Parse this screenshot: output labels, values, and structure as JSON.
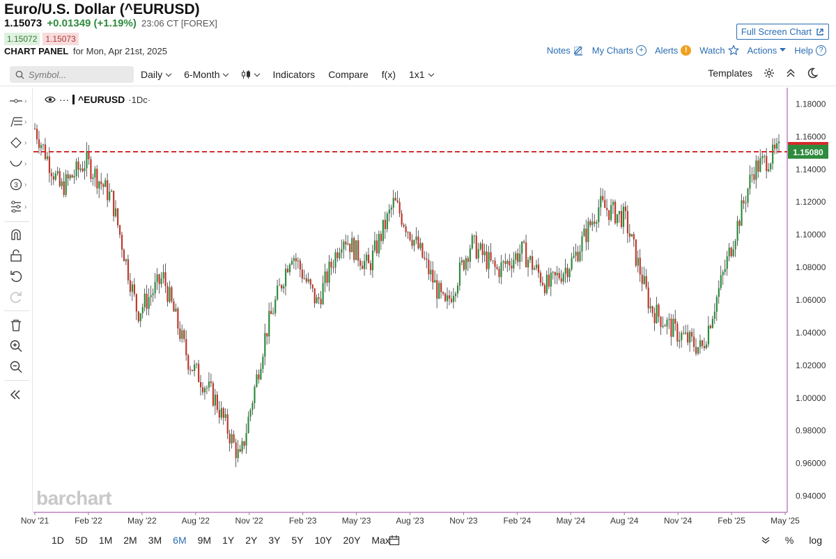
{
  "header": {
    "title": "Euro/U.S. Dollar (^EURUSD)",
    "last": "1.15073",
    "change": "+0.01349 (+1.19%)",
    "time": "23:06 CT [FOREX]",
    "bid": "1.15072",
    "ask": "1.15073",
    "panel_label": "CHART PANEL",
    "panel_date": "for Mon, Apr 21st, 2025",
    "fullscreen_label": "Full Screen Chart",
    "links": {
      "notes": "Notes",
      "mycharts": "My Charts",
      "alerts": "Alerts",
      "alerts_badge": "!",
      "watch": "Watch",
      "actions": "Actions",
      "help": "Help"
    }
  },
  "toolbar": {
    "symbol_placeholder": "Symbol...",
    "interval": "Daily",
    "period": "6-Month",
    "indicators": "Indicators",
    "compare": "Compare",
    "fx": "f(x)",
    "layout": "1x1",
    "templates": "Templates"
  },
  "legend": {
    "symbol": "^EURUSD",
    "timeframe": "·1Dc·",
    "dots": "···"
  },
  "watermark": "barchart",
  "chart_data": {
    "type": "candlestick",
    "symbol": "^EURUSD",
    "interval": "1D",
    "ylim": [
      0.93,
      1.19
    ],
    "y_ticks": [
      "1.18000",
      "1.16000",
      "1.14000",
      "1.12000",
      "1.10000",
      "1.08000",
      "1.06000",
      "1.04000",
      "1.02000",
      "1.00000",
      "0.98000",
      "0.96000",
      "0.94000"
    ],
    "x_ticks": [
      "Nov '21",
      "Feb '22",
      "May '22",
      "Aug '22",
      "Nov '22",
      "Feb '23",
      "May '23",
      "Aug '23",
      "Nov '23",
      "Feb '24",
      "May '24",
      "Aug '24",
      "Nov '24",
      "Feb '25",
      "May '25"
    ],
    "last_price_label": "1.15080",
    "reference_line": 1.1508,
    "close_path": [
      [
        "Nov '21",
        1.165
      ],
      [
        "Nov '21",
        1.128
      ],
      [
        "Feb '22",
        1.145
      ],
      [
        "Feb '22",
        1.122
      ],
      [
        "May '22",
        1.052
      ],
      [
        "May '22",
        1.074
      ],
      [
        "Aug '22",
        1.022
      ],
      [
        "Aug '22",
        1.0
      ],
      [
        "Nov '22",
        0.962
      ],
      [
        "Nov '22",
        1.04
      ],
      [
        "Feb '23",
        1.09
      ],
      [
        "Feb '23",
        1.058
      ],
      [
        "May '23",
        1.1
      ],
      [
        "May '23",
        1.08
      ],
      [
        "Aug '23",
        1.12
      ],
      [
        "Aug '23",
        1.09
      ],
      [
        "Nov '23",
        1.055
      ],
      [
        "Nov '23",
        1.095
      ],
      [
        "Feb '24",
        1.078
      ],
      [
        "Feb '24",
        1.09
      ],
      [
        "May '24",
        1.068
      ],
      [
        "May '24",
        1.085
      ],
      [
        "Aug '24",
        1.118
      ],
      [
        "Aug '24",
        1.11
      ],
      [
        "Nov '24",
        1.055
      ],
      [
        "Nov '24",
        1.04
      ],
      [
        "Feb '25",
        1.03
      ],
      [
        "Feb '25",
        1.085
      ],
      [
        "May '25",
        1.14
      ],
      [
        "May '25",
        1.151
      ]
    ]
  },
  "bottom": {
    "ranges": [
      "1D",
      "5D",
      "1M",
      "2M",
      "3M",
      "6M",
      "9M",
      "1Y",
      "2Y",
      "3Y",
      "5Y",
      "10Y",
      "20Y",
      "Max"
    ],
    "active_range": "6M",
    "percent": "%",
    "log": "log"
  },
  "colors": {
    "up": "#2e8b3d",
    "down": "#c0392b",
    "accent": "#2a6db3",
    "ref_line": "#d42a2a",
    "last_badge": "#2e8b3d",
    "frame": "#a040a0"
  }
}
